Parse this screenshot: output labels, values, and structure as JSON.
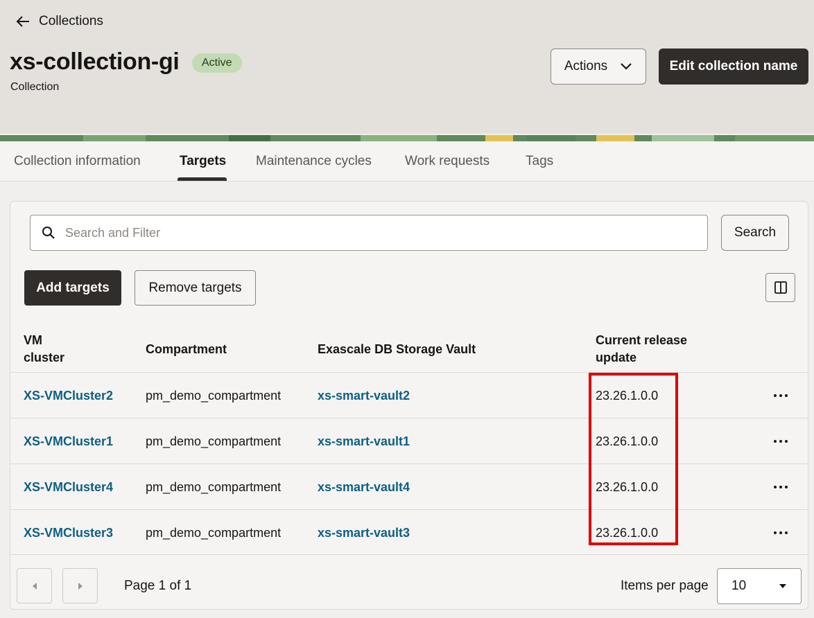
{
  "header": {
    "back_label": "Collections",
    "title": "xs-collection-gi",
    "status": "Active",
    "subtitle": "Collection",
    "actions_label": "Actions",
    "edit_label": "Edit collection name"
  },
  "tabs": [
    {
      "label": "Collection information"
    },
    {
      "label": "Targets",
      "active": true
    },
    {
      "label": "Maintenance cycles"
    },
    {
      "label": "Work requests"
    },
    {
      "label": "Tags"
    }
  ],
  "search": {
    "placeholder": "Search and Filter",
    "button_label": "Search"
  },
  "toolbar": {
    "add_label": "Add targets",
    "remove_label": "Remove targets"
  },
  "table": {
    "headers": {
      "vm_cluster_line1": "VM",
      "vm_cluster_line2": "cluster",
      "compartment": "Compartment",
      "vault": "Exascale DB Storage Vault",
      "release_line1": "Current release",
      "release_line2": "update"
    },
    "rows": [
      {
        "vm_cluster": "XS-VMCluster2",
        "compartment": "pm_demo_compartment",
        "vault": "xs-smart-vault2",
        "release": "23.26.1.0.0"
      },
      {
        "vm_cluster": "XS-VMCluster1",
        "compartment": "pm_demo_compartment",
        "vault": "xs-smart-vault1",
        "release": "23.26.1.0.0"
      },
      {
        "vm_cluster": "XS-VMCluster4",
        "compartment": "pm_demo_compartment",
        "vault": "xs-smart-vault4",
        "release": "23.26.1.0.0"
      },
      {
        "vm_cluster": "XS-VMCluster3",
        "compartment": "pm_demo_compartment",
        "vault": "xs-smart-vault3",
        "release": "23.26.1.0.0"
      }
    ]
  },
  "pagination": {
    "page_info": "Page 1 of 1",
    "items_per_page_label": "Items per page",
    "items_per_page": "10"
  },
  "colors": {
    "link": "#0d5f85",
    "primary_button": "#312d2a",
    "status_badge": "#c4dab4",
    "highlight": "#e00000"
  }
}
